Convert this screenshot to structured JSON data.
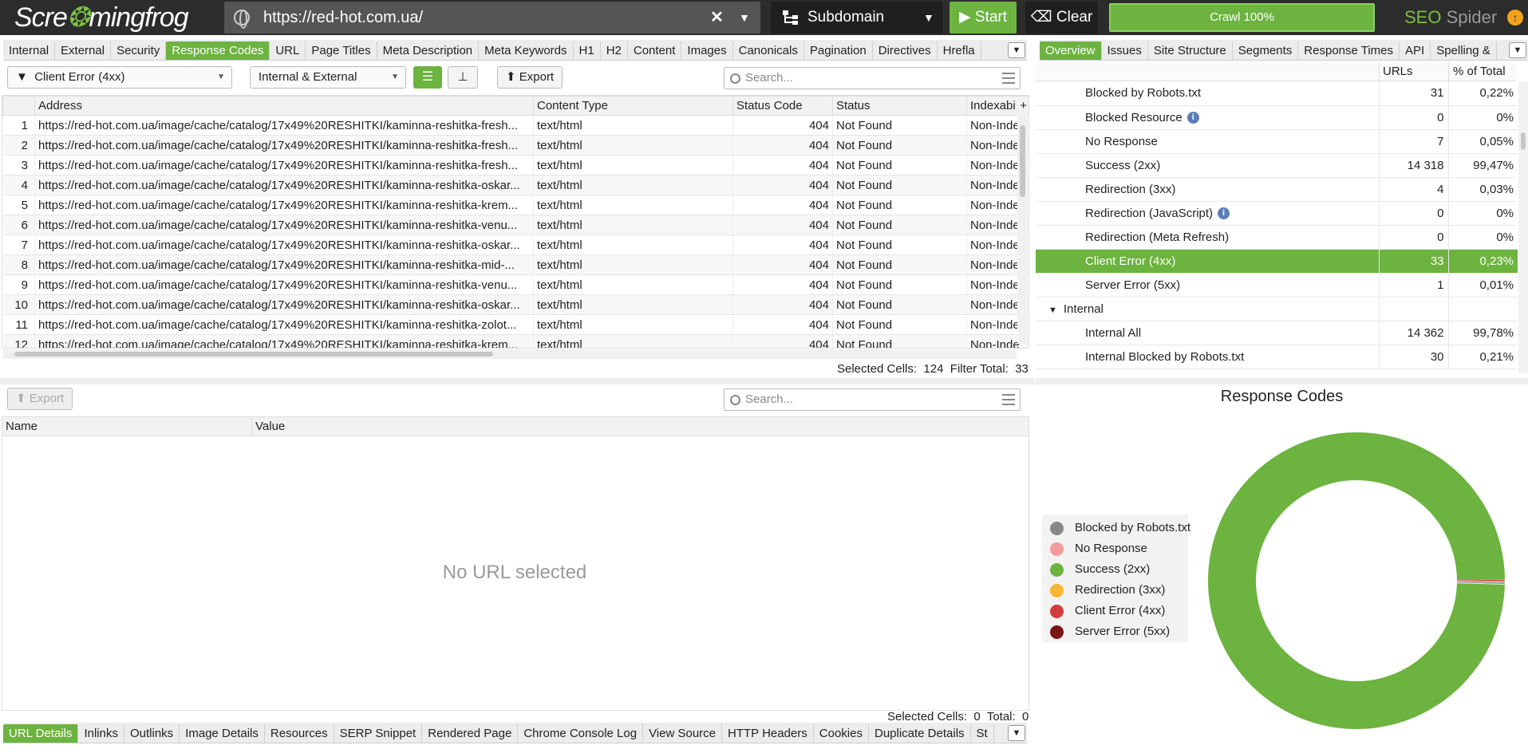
{
  "app": {
    "logo_pre": "Scre",
    "logo_post": "mingfrog",
    "url": "https://red-hot.com.ua/",
    "mode": "Subdomain",
    "start": "Start",
    "clear": "Clear",
    "crawl": "Crawl 100%",
    "brand_seo": "SEO",
    "brand_spider": "Spider"
  },
  "main_tabs": [
    "Internal",
    "External",
    "Security",
    "Response Codes",
    "URL",
    "Page Titles",
    "Meta Description",
    "Meta Keywords",
    "H1",
    "H2",
    "Content",
    "Images",
    "Canonicals",
    "Pagination",
    "Directives",
    "Hrefla"
  ],
  "toolbar": {
    "filter": "Client Error (4xx)",
    "scope": "Internal & External",
    "export": "Export",
    "search_placeholder": "Search..."
  },
  "table": {
    "columns": [
      "Address",
      "Content Type",
      "Status Code",
      "Status",
      "Indexabi"
    ],
    "rows": [
      {
        "n": "1",
        "address": "https://red-hot.com.ua/image/cache/catalog/17x49%20RESHITKI/kaminna-reshitka-fresh...",
        "ctype": "text/html",
        "code": "404",
        "status": "Not Found",
        "index": "Non-Inde"
      },
      {
        "n": "2",
        "address": "https://red-hot.com.ua/image/cache/catalog/17x49%20RESHITKI/kaminna-reshitka-fresh...",
        "ctype": "text/html",
        "code": "404",
        "status": "Not Found",
        "index": "Non-Inde"
      },
      {
        "n": "3",
        "address": "https://red-hot.com.ua/image/cache/catalog/17x49%20RESHITKI/kaminna-reshitka-fresh...",
        "ctype": "text/html",
        "code": "404",
        "status": "Not Found",
        "index": "Non-Inde"
      },
      {
        "n": "4",
        "address": "https://red-hot.com.ua/image/cache/catalog/17x49%20RESHITKI/kaminna-reshitka-oskar...",
        "ctype": "text/html",
        "code": "404",
        "status": "Not Found",
        "index": "Non-Inde"
      },
      {
        "n": "5",
        "address": "https://red-hot.com.ua/image/cache/catalog/17x49%20RESHITKI/kaminna-reshitka-krem...",
        "ctype": "text/html",
        "code": "404",
        "status": "Not Found",
        "index": "Non-Inde"
      },
      {
        "n": "6",
        "address": "https://red-hot.com.ua/image/cache/catalog/17x49%20RESHITKI/kaminna-reshitka-venu...",
        "ctype": "text/html",
        "code": "404",
        "status": "Not Found",
        "index": "Non-Inde"
      },
      {
        "n": "7",
        "address": "https://red-hot.com.ua/image/cache/catalog/17x49%20RESHITKI/kaminna-reshitka-oskar...",
        "ctype": "text/html",
        "code": "404",
        "status": "Not Found",
        "index": "Non-Inde"
      },
      {
        "n": "8",
        "address": "https://red-hot.com.ua/image/cache/catalog/17x49%20RESHITKI/kaminna-reshitka-mid-...",
        "ctype": "text/html",
        "code": "404",
        "status": "Not Found",
        "index": "Non-Inde"
      },
      {
        "n": "9",
        "address": "https://red-hot.com.ua/image/cache/catalog/17x49%20RESHITKI/kaminna-reshitka-venu...",
        "ctype": "text/html",
        "code": "404",
        "status": "Not Found",
        "index": "Non-Inde"
      },
      {
        "n": "10",
        "address": "https://red-hot.com.ua/image/cache/catalog/17x49%20RESHITKI/kaminna-reshitka-oskar...",
        "ctype": "text/html",
        "code": "404",
        "status": "Not Found",
        "index": "Non-Inde"
      },
      {
        "n": "11",
        "address": "https://red-hot.com.ua/image/cache/catalog/17x49%20RESHITKI/kaminna-reshitka-zolot...",
        "ctype": "text/html",
        "code": "404",
        "status": "Not Found",
        "index": "Non-Inde"
      },
      {
        "n": "12",
        "address": "https://red-hot.com.ua/image/cache/catalog/17x49%20RESHITKI/kaminna-reshitka-krem...",
        "ctype": "text/html",
        "code": "404",
        "status": "Not Found",
        "index": "Non-Inde"
      }
    ]
  },
  "table_status": {
    "selected_label": "Selected Cells:",
    "selected": "124",
    "filter_label": "Filter Total:",
    "filter_total": "33"
  },
  "lower": {
    "export": "Export",
    "search_placeholder": "Search...",
    "col_name": "Name",
    "col_value": "Value",
    "empty": "No URL selected",
    "selected_label": "Selected Cells:",
    "selected": "0",
    "total_label": "Total:",
    "total": "0"
  },
  "bottom_tabs": [
    "URL Details",
    "Inlinks",
    "Outlinks",
    "Image Details",
    "Resources",
    "SERP Snippet",
    "Rendered Page",
    "Chrome Console Log",
    "View Source",
    "HTTP Headers",
    "Cookies",
    "Duplicate Details",
    "St"
  ],
  "right_tabs": [
    "Overview",
    "Issues",
    "Site Structure",
    "Segments",
    "Response Times",
    "API",
    "Spelling &"
  ],
  "overview": {
    "col_urls": "URLs",
    "col_pct": "% of Total",
    "rows": [
      {
        "label": "Blocked by Robots.txt",
        "urls": "31",
        "pct": "0,22%",
        "indent": 2,
        "info": false
      },
      {
        "label": "Blocked Resource",
        "urls": "0",
        "pct": "0%",
        "indent": 2,
        "info": true
      },
      {
        "label": "No Response",
        "urls": "7",
        "pct": "0,05%",
        "indent": 2,
        "info": false
      },
      {
        "label": "Success (2xx)",
        "urls": "14 318",
        "pct": "99,47%",
        "indent": 2,
        "info": false
      },
      {
        "label": "Redirection (3xx)",
        "urls": "4",
        "pct": "0,03%",
        "indent": 2,
        "info": false
      },
      {
        "label": "Redirection (JavaScript)",
        "urls": "0",
        "pct": "0%",
        "indent": 2,
        "info": true
      },
      {
        "label": "Redirection (Meta Refresh)",
        "urls": "0",
        "pct": "0%",
        "indent": 2,
        "info": false
      },
      {
        "label": "Client Error (4xx)",
        "urls": "33",
        "pct": "0,23%",
        "indent": 2,
        "info": false,
        "selected": true
      },
      {
        "label": "Server Error (5xx)",
        "urls": "1",
        "pct": "0,01%",
        "indent": 2,
        "info": false
      },
      {
        "label": "Internal",
        "urls": "",
        "pct": "",
        "indent": 1,
        "info": false,
        "group": true
      },
      {
        "label": "Internal All",
        "urls": "14 362",
        "pct": "99,78%",
        "indent": 2,
        "info": false
      },
      {
        "label": "Internal Blocked by Robots.txt",
        "urls": "30",
        "pct": "0,21%",
        "indent": 2,
        "info": false
      }
    ]
  },
  "chart_data": {
    "type": "pie",
    "title": "Response Codes",
    "series": [
      {
        "name": "Blocked by Robots.txt",
        "value": 31,
        "color": "#888888"
      },
      {
        "name": "No Response",
        "value": 7,
        "color": "#f39a9a"
      },
      {
        "name": "Success (2xx)",
        "value": 14318,
        "color": "#6cb33f"
      },
      {
        "name": "Redirection (3xx)",
        "value": 4,
        "color": "#f7b733"
      },
      {
        "name": "Client Error (4xx)",
        "value": 33,
        "color": "#d23c3c"
      },
      {
        "name": "Server Error (5xx)",
        "value": 1,
        "color": "#7a1515"
      }
    ],
    "legend": "left"
  },
  "colors": {
    "accent": "#6cb33f",
    "topbar": "#2c2c2c"
  }
}
